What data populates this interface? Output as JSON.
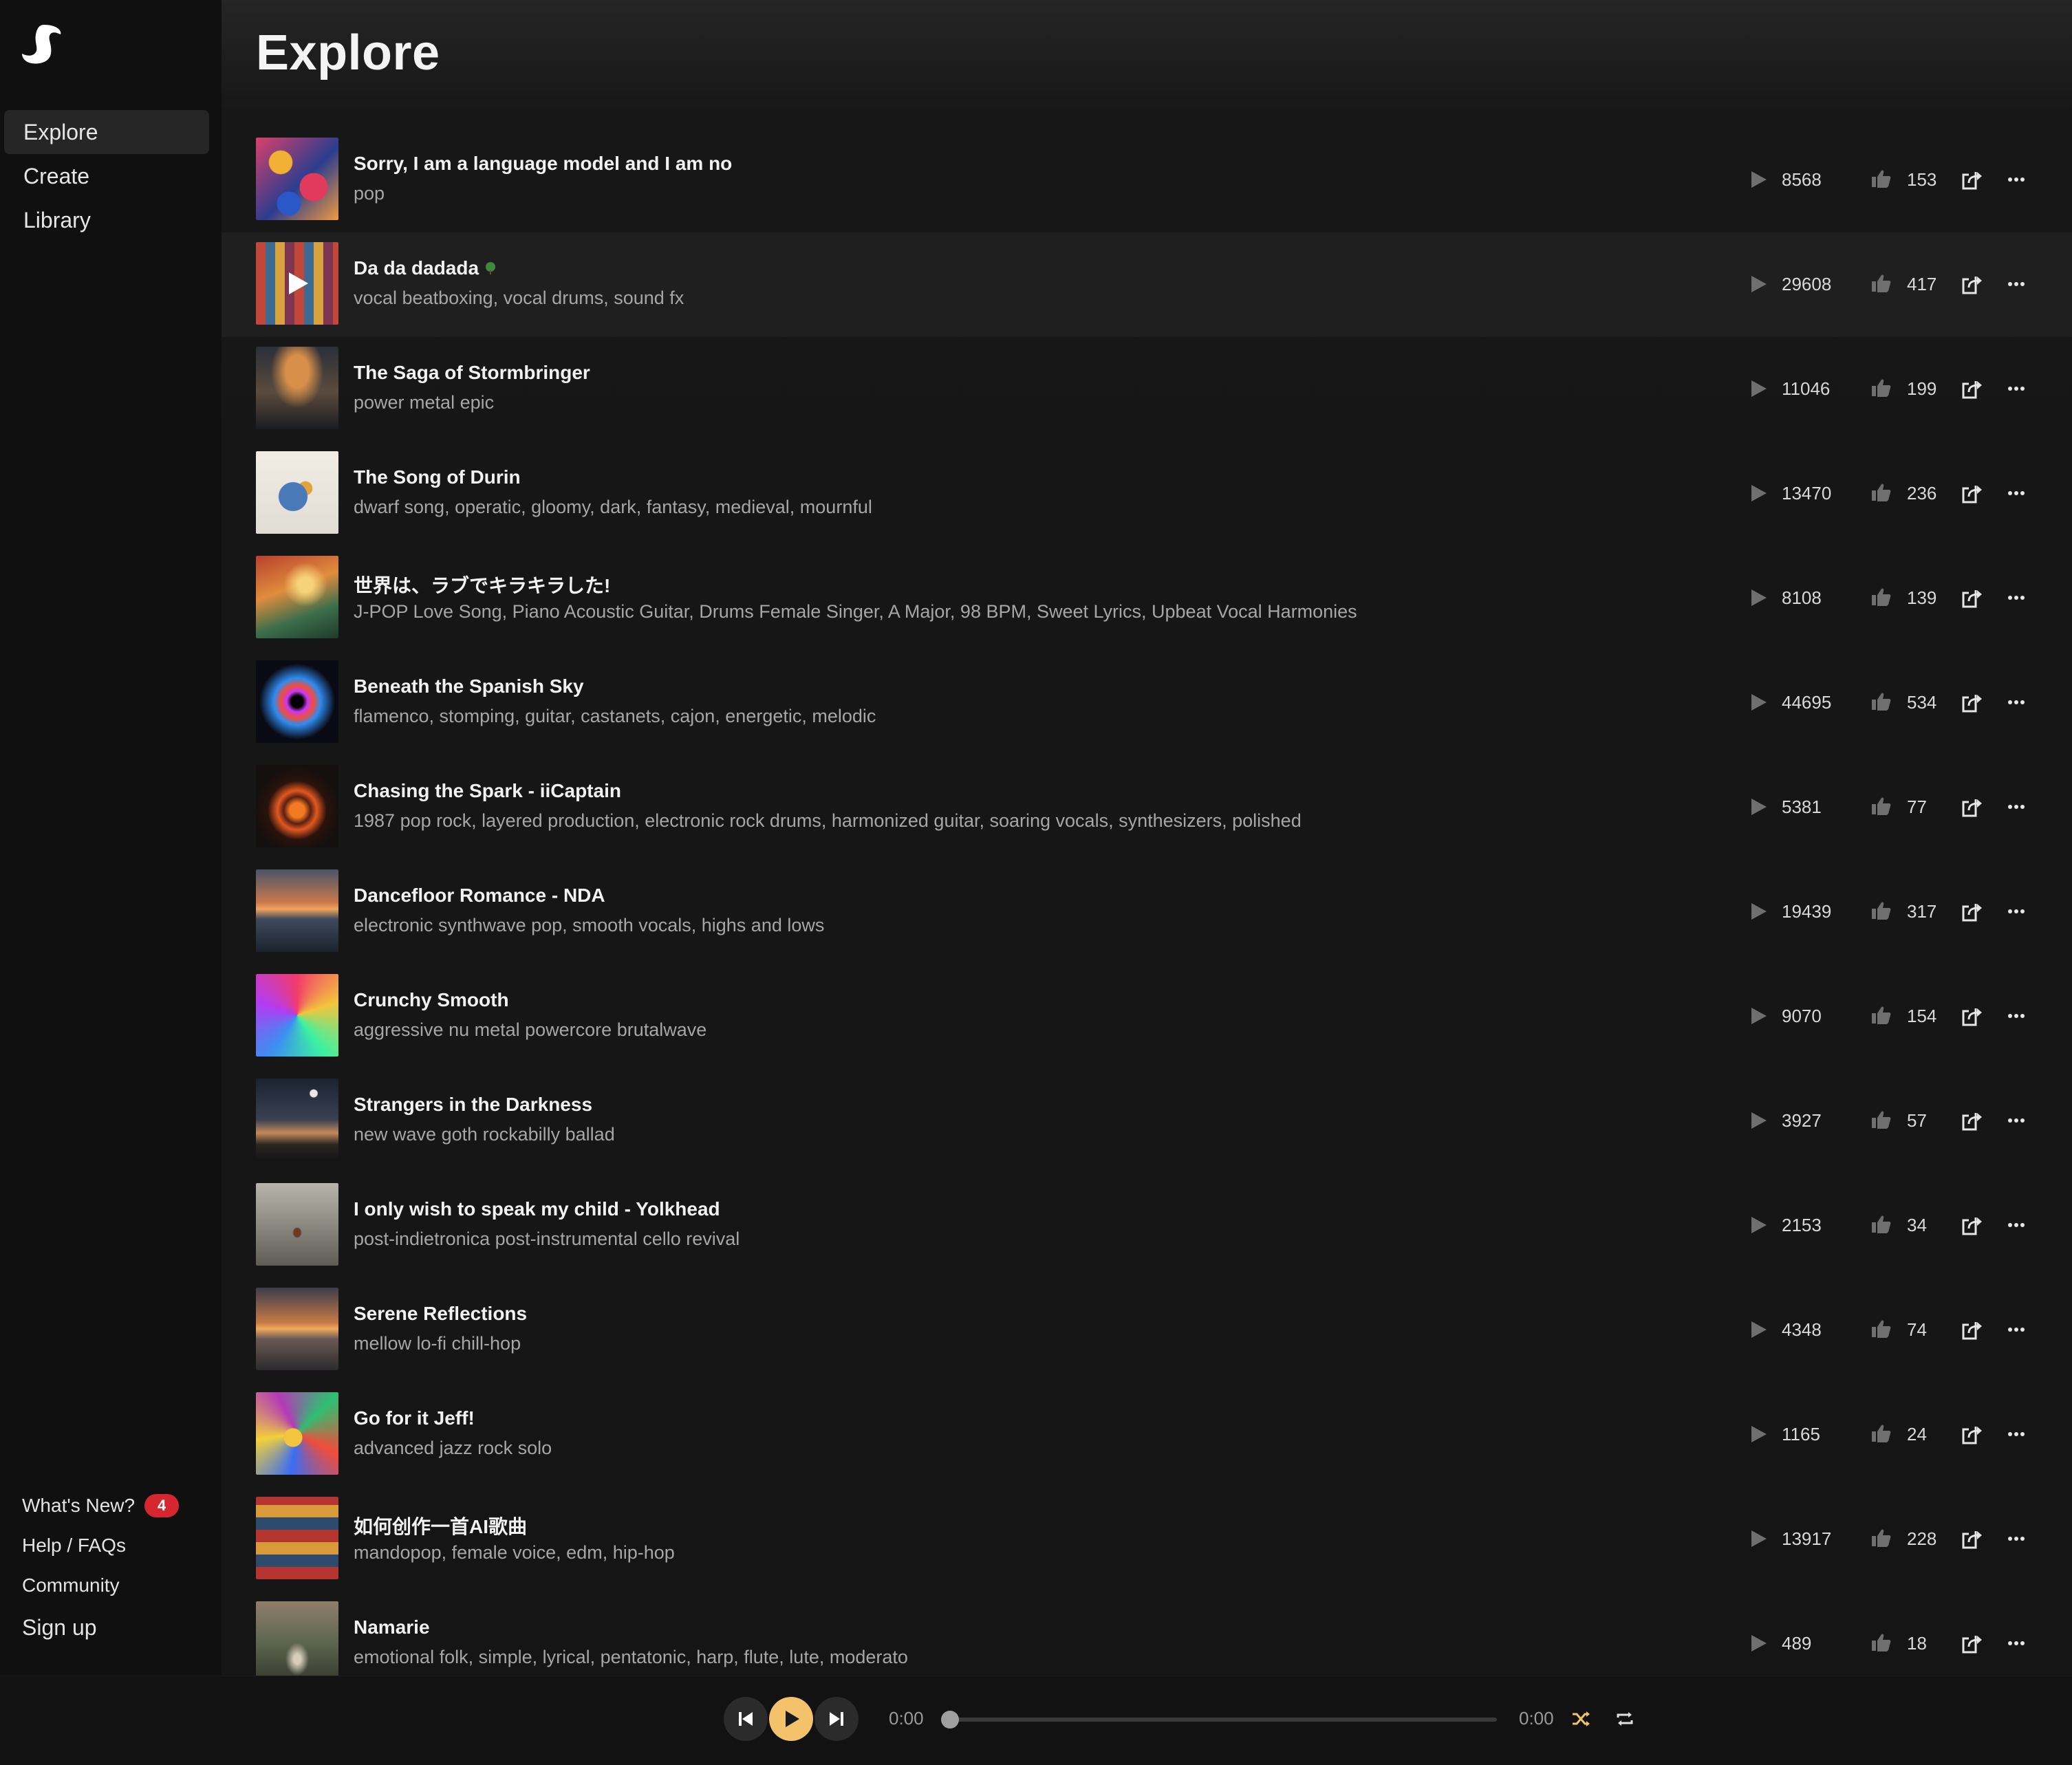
{
  "sidebar": {
    "logo": "suno-logo",
    "nav": [
      {
        "label": "Explore",
        "active": true
      },
      {
        "label": "Create",
        "active": false
      },
      {
        "label": "Library",
        "active": false
      }
    ],
    "footer": {
      "whats_new": "What's New?",
      "whats_new_badge": "4",
      "help": "Help / FAQs",
      "community": "Community",
      "signup": "Sign up"
    }
  },
  "main": {
    "title": "Explore",
    "songs": [
      {
        "title": "Sorry, I am a language model and I am no",
        "tags": "pop",
        "plays": "8568",
        "likes": "153"
      },
      {
        "title": "Da da dadada",
        "tags": "vocal beatboxing, vocal drums, sound fx",
        "plays": "29608",
        "likes": "417"
      },
      {
        "title": "The Saga of Stormbringer",
        "tags": "power metal epic",
        "plays": "11046",
        "likes": "199"
      },
      {
        "title": "The Song of Durin",
        "tags": "dwarf song, operatic, gloomy, dark, fantasy, medieval, mournful",
        "plays": "13470",
        "likes": "236"
      },
      {
        "title": "世界は、ラブでキラキラした!",
        "tags": "J-POP Love Song, Piano Acoustic Guitar, Drums Female Singer, A Major, 98 BPM, Sweet Lyrics, Upbeat Vocal Harmonies",
        "plays": "8108",
        "likes": "139"
      },
      {
        "title": "Beneath the Spanish Sky",
        "tags": "flamenco, stomping, guitar, castanets, cajon, energetic, melodic",
        "plays": "44695",
        "likes": "534"
      },
      {
        "title": "Chasing the Spark - iiCaptain",
        "tags": "1987 pop rock, layered production, electronic rock drums, harmonized guitar, soaring vocals, synthesizers, polished",
        "plays": "5381",
        "likes": "77"
      },
      {
        "title": "Dancefloor Romance - NDA",
        "tags": "electronic synthwave pop, smooth vocals, highs and lows",
        "plays": "19439",
        "likes": "317"
      },
      {
        "title": "Crunchy Smooth",
        "tags": "aggressive nu metal powercore brutalwave",
        "plays": "9070",
        "likes": "154"
      },
      {
        "title": "Strangers in the Darkness",
        "tags": "new wave goth rockabilly ballad",
        "plays": "3927",
        "likes": "57"
      },
      {
        "title": "I only wish to speak my child - Yolkhead",
        "tags": "post-indietronica post-instrumental cello revival",
        "plays": "2153",
        "likes": "34"
      },
      {
        "title": "Serene Reflections",
        "tags": "mellow lo-fi chill-hop",
        "plays": "4348",
        "likes": "74"
      },
      {
        "title": "Go for it Jeff!",
        "tags": "advanced jazz rock solo",
        "plays": "1165",
        "likes": "24"
      },
      {
        "title": "如何创作一首AI歌曲",
        "tags": "mandopop, female voice, edm, hip-hop",
        "plays": "13917",
        "likes": "228"
      },
      {
        "title": "Namarie",
        "tags": "emotional folk, simple, lyrical, pentatonic, harp, flute, lute, moderato",
        "plays": "489",
        "likes": "18"
      }
    ]
  },
  "player": {
    "current_time": "0:00",
    "duration": "0:00",
    "progress": 0,
    "icons": [
      "previous-icon",
      "play-icon",
      "next-icon",
      "shuffle-icon",
      "repeat-icon"
    ]
  },
  "colors": {
    "accent": "#f3c26b",
    "badge": "#d6262f",
    "background": "#151515",
    "sidebar": "#101010"
  }
}
